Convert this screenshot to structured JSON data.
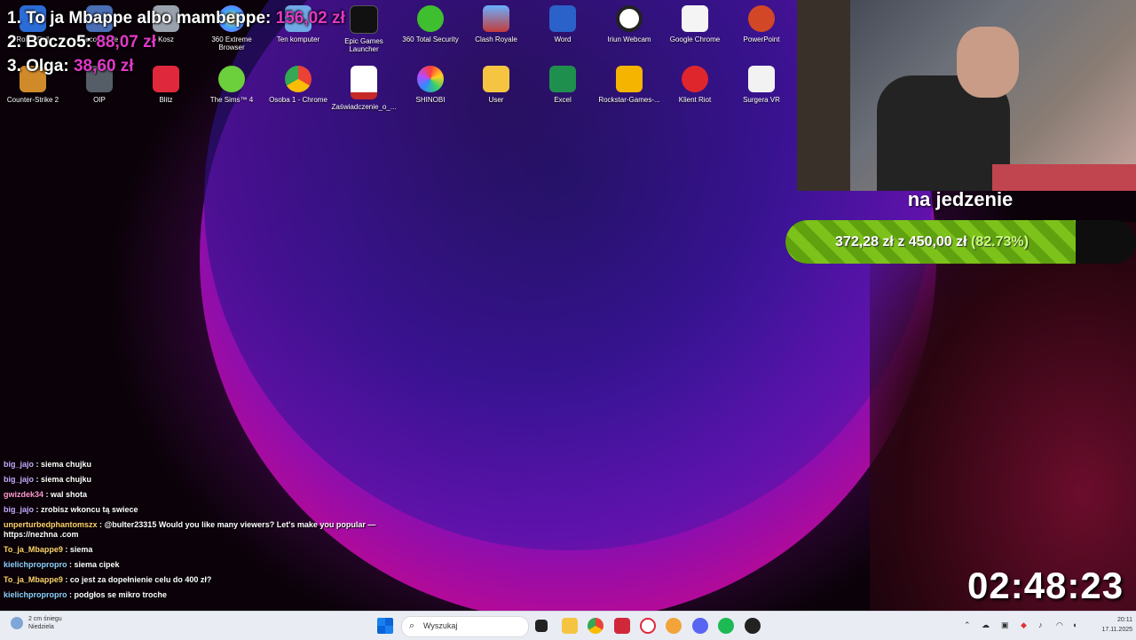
{
  "leaderboard": [
    {
      "rank_name": "1. To ja Mbappe albo mambeppe:",
      "amount": "156,02 zł"
    },
    {
      "rank_name": "2. Boczo5:",
      "amount": "88,07 zł"
    },
    {
      "rank_name": "3. Olga:",
      "amount": "38,60 zł"
    }
  ],
  "desktop_icons_row1": [
    "Robot Roll",
    "Second Life",
    "Kosz",
    "360 Extreme Browser",
    "Ten komputer",
    "Epic Games Launcher",
    "360 Total Security",
    "Clash Royale",
    "Word",
    "Iriun Webcam",
    "Google Chrome",
    "PowerPoint"
  ],
  "desktop_icons_row2": [
    "Counter-Strike 2",
    "OIP",
    "Blitz",
    "The Sims™ 4",
    "Osoba 1 - Chrome",
    "Zaświadczenie_o_...",
    "SHINOBI",
    "User",
    "Excel",
    "Rockstar-Games-...",
    "Klient Riot",
    "Surgera VR"
  ],
  "goal": {
    "title": "na jedzenie",
    "current": "372,28 zł",
    "separator": "z",
    "target": "450,00 zł",
    "percent_label": "(82.73%)",
    "progress": 0.8273
  },
  "chat": [
    {
      "user": "big_jajo",
      "color": "#c8a8ff",
      "msg": "siema chujku"
    },
    {
      "user": "big_jajo",
      "color": "#c8a8ff",
      "msg": "siema chujku"
    },
    {
      "user": "gwizdek34",
      "color": "#ff9ad1",
      "msg": "wal shota"
    },
    {
      "user": "big_jajo",
      "color": "#c8a8ff",
      "msg": "zrobisz wkoncu tą swiece"
    },
    {
      "user": "unperturbedphantomszx",
      "color": "#ffd36b",
      "msg": "@bulter23315 Would you like many viewers? Let's make you popular — https://nezhna .com"
    },
    {
      "user": "To_ja_Mbappe9",
      "color": "#ffd36b",
      "msg": "siema"
    },
    {
      "user": "kielichpropropro",
      "color": "#8fd1ff",
      "msg": "siema cipek"
    },
    {
      "user": "To_ja_Mbappe9",
      "color": "#ffd36b",
      "msg": "co jest za dopełnienie celu do 400 zł?"
    },
    {
      "user": "kielichpropropro",
      "color": "#8fd1ff",
      "msg": "podgłos se mikro troche"
    }
  ],
  "timer": "02:48:23",
  "taskbar": {
    "weather_line1": "2 cm śniegu",
    "weather_line2": "Niedziela",
    "search_placeholder": "Wyszukaj",
    "time": "20:11",
    "date": "17.11.2025"
  }
}
